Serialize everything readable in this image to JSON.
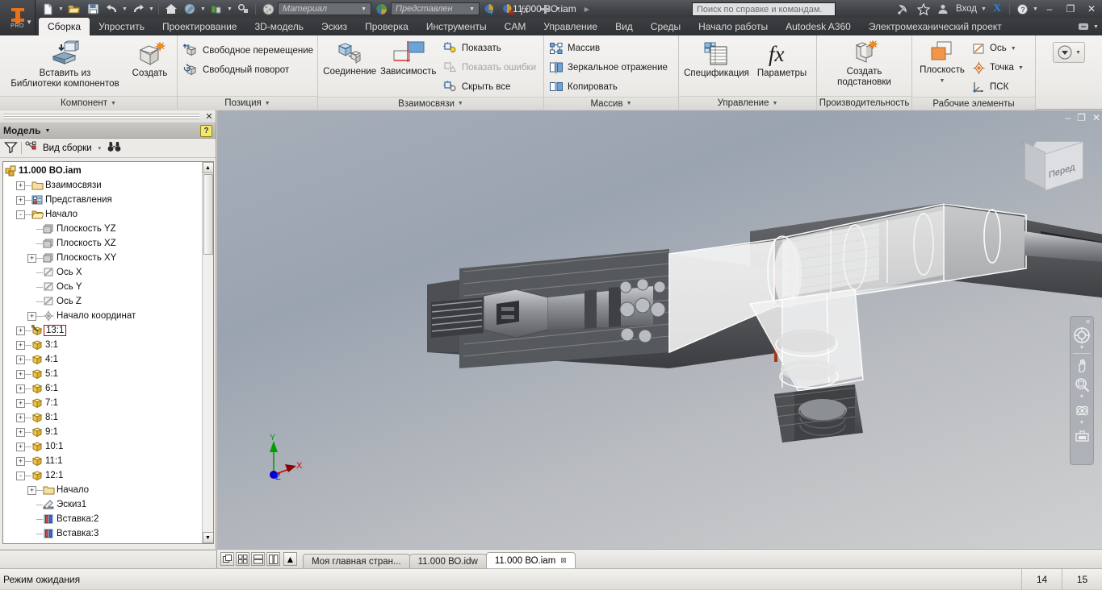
{
  "titlebar": {
    "document_title": "11.000 ВО.iam",
    "material_combo": "Материал",
    "appearance_combo": "Представлен",
    "search_placeholder": "Поиск по справке и командам.",
    "signin_label": "Вход",
    "minimize": "–",
    "restore": "❐",
    "close": "✕",
    "quick_access": [
      {
        "name": "new-file-icon",
        "label": "Создать"
      },
      {
        "name": "open-file-icon",
        "label": "Открыть"
      },
      {
        "name": "save-icon",
        "label": "Сохранить"
      },
      {
        "name": "undo-icon",
        "label": "Отменить"
      },
      {
        "name": "redo-icon",
        "label": "Повторить"
      },
      {
        "name": "home-icon",
        "label": "Домой"
      },
      {
        "name": "appearance-icon",
        "label": "Внешний вид"
      },
      {
        "name": "update-icon",
        "label": "Обновить"
      },
      {
        "name": "select-icon",
        "label": "Выбрать"
      }
    ]
  },
  "tabs": [
    {
      "label": "Сборка",
      "active": true
    },
    {
      "label": "Упростить",
      "active": false
    },
    {
      "label": "Проектирование",
      "active": false
    },
    {
      "label": "3D-модель",
      "active": false
    },
    {
      "label": "Эскиз",
      "active": false
    },
    {
      "label": "Проверка",
      "active": false
    },
    {
      "label": "Инструменты",
      "active": false
    },
    {
      "label": "CAM",
      "active": false
    },
    {
      "label": "Управление",
      "active": false
    },
    {
      "label": "Вид",
      "active": false
    },
    {
      "label": "Среды",
      "active": false
    },
    {
      "label": "Начало работы",
      "active": false
    },
    {
      "label": "Autodesk A360",
      "active": false
    },
    {
      "label": "Электромеханический проект",
      "active": false
    }
  ],
  "ribbon": {
    "panels": [
      {
        "title": "Компонент",
        "has_caret": true,
        "big_buttons": [
          {
            "label_line1": "Вставить из",
            "label_line2": "Библиотеки компонентов",
            "icon": "insert-from-library-icon",
            "dropdown": true
          },
          {
            "label_line1": "Создать",
            "label_line2": "",
            "icon": "create-component-icon",
            "dropdown": false
          }
        ]
      },
      {
        "title": "Позиция",
        "has_caret": true,
        "small_buttons": [
          {
            "label": "Свободное перемещение",
            "icon": "free-move-icon",
            "disabled": false
          },
          {
            "label": "Свободный поворот",
            "icon": "free-rotate-icon",
            "disabled": false
          }
        ]
      },
      {
        "title": "Взаимосвязи",
        "has_caret": true,
        "big_buttons": [
          {
            "label_line1": "Соединение",
            "label_line2": "",
            "icon": "joint-icon",
            "dropdown": false
          },
          {
            "label_line1": "Зависимость",
            "label_line2": "",
            "icon": "constraint-icon",
            "dropdown": false
          }
        ],
        "small_buttons": [
          {
            "label": "Показать",
            "icon": "show-constraints-icon",
            "disabled": false
          },
          {
            "label": "Показать ошибки",
            "icon": "show-errors-icon",
            "disabled": true
          },
          {
            "label": "Скрыть все",
            "icon": "hide-all-icon",
            "disabled": false
          }
        ]
      },
      {
        "title": "Массив",
        "has_caret": true,
        "small_buttons": [
          {
            "label": "Массив",
            "icon": "pattern-icon",
            "disabled": false
          },
          {
            "label": "Зеркальное отражение",
            "icon": "mirror-icon",
            "disabled": false
          },
          {
            "label": "Копировать",
            "icon": "copy-icon",
            "disabled": false
          }
        ]
      },
      {
        "title": "Управление",
        "has_caret": true,
        "big_buttons": [
          {
            "label_line1": "Спецификация",
            "label_line2": "",
            "icon": "bom-icon",
            "dropdown": false
          },
          {
            "label_line1": "Параметры",
            "label_line2": "",
            "icon": "parameters-fx-icon",
            "dropdown": false
          }
        ]
      },
      {
        "title": "Производительность",
        "has_caret": false,
        "big_buttons": [
          {
            "label_line1": "Создать",
            "label_line2": "подстановки",
            "icon": "create-substitute-icon",
            "dropdown": true
          }
        ]
      },
      {
        "title": "Рабочие элементы",
        "has_caret": false,
        "big_buttons": [
          {
            "label_line1": "Плоскость",
            "label_line2": "",
            "icon": "work-plane-icon",
            "dropdown": true
          }
        ],
        "small_buttons": [
          {
            "label": "Ось",
            "icon": "work-axis-icon",
            "disabled": false,
            "dropdown": true
          },
          {
            "label": "Точка",
            "icon": "work-point-icon",
            "disabled": false,
            "dropdown": true
          },
          {
            "label": "ПСК",
            "icon": "ucs-icon",
            "disabled": false,
            "dropdown": false
          }
        ]
      },
      {
        "title": "",
        "has_caret": false,
        "big_buttons": [
          {
            "label_line1": "",
            "label_line2": "",
            "icon": "panel-overflow-icon",
            "dropdown": true
          }
        ]
      }
    ]
  },
  "browser": {
    "panel_title": "Модель",
    "help_badge": "?",
    "toolbar": {
      "filter_icon": "filter-icon",
      "view_rep_label": "Вид сборки",
      "view_rep_caret": "▾",
      "find_icon": "binoculars-icon"
    },
    "tree": [
      {
        "label": "11.000 ВО.iam",
        "depth": 0,
        "expander": "",
        "icon": "assembly-icon",
        "bold": true,
        "selected": false
      },
      {
        "label": "Взаимосвязи",
        "depth": 1,
        "expander": "+",
        "icon": "folder-icon",
        "bold": false,
        "selected": false
      },
      {
        "label": "Представления",
        "depth": 1,
        "expander": "+",
        "icon": "representations-icon",
        "bold": false,
        "selected": false
      },
      {
        "label": "Начало",
        "depth": 1,
        "expander": "-",
        "icon": "open-folder-icon",
        "bold": false,
        "selected": false
      },
      {
        "label": "Плоскость YZ",
        "depth": 2,
        "expander": "",
        "icon": "plane-icon",
        "bold": false,
        "selected": false
      },
      {
        "label": "Плоскость XZ",
        "depth": 2,
        "expander": "",
        "icon": "plane-icon",
        "bold": false,
        "selected": false
      },
      {
        "label": "Плоскость XY",
        "depth": 2,
        "expander": "+",
        "icon": "plane-icon",
        "bold": false,
        "selected": false
      },
      {
        "label": "Ось X",
        "depth": 2,
        "expander": "",
        "icon": "axis-icon",
        "bold": false,
        "selected": false
      },
      {
        "label": "Ось Y",
        "depth": 2,
        "expander": "",
        "icon": "axis-icon",
        "bold": false,
        "selected": false
      },
      {
        "label": "Ось Z",
        "depth": 2,
        "expander": "",
        "icon": "axis-icon",
        "bold": false,
        "selected": false
      },
      {
        "label": "Начало координат",
        "depth": 2,
        "expander": "+",
        "icon": "origin-point-icon",
        "bold": false,
        "selected": false
      },
      {
        "label": "13:1",
        "depth": 1,
        "expander": "+",
        "icon": "grounded-component-icon",
        "bold": false,
        "selected": true
      },
      {
        "label": "3:1",
        "depth": 1,
        "expander": "+",
        "icon": "component-icon",
        "bold": false,
        "selected": false
      },
      {
        "label": "4:1",
        "depth": 1,
        "expander": "+",
        "icon": "component-icon",
        "bold": false,
        "selected": false
      },
      {
        "label": "5:1",
        "depth": 1,
        "expander": "+",
        "icon": "component-icon",
        "bold": false,
        "selected": false
      },
      {
        "label": "6:1",
        "depth": 1,
        "expander": "+",
        "icon": "component-icon",
        "bold": false,
        "selected": false
      },
      {
        "label": "7:1",
        "depth": 1,
        "expander": "+",
        "icon": "component-icon",
        "bold": false,
        "selected": false
      },
      {
        "label": "8:1",
        "depth": 1,
        "expander": "+",
        "icon": "component-icon",
        "bold": false,
        "selected": false
      },
      {
        "label": "9:1",
        "depth": 1,
        "expander": "+",
        "icon": "component-icon",
        "bold": false,
        "selected": false
      },
      {
        "label": "10:1",
        "depth": 1,
        "expander": "+",
        "icon": "component-icon",
        "bold": false,
        "selected": false
      },
      {
        "label": "11:1",
        "depth": 1,
        "expander": "+",
        "icon": "component-icon",
        "bold": false,
        "selected": false
      },
      {
        "label": "12:1",
        "depth": 1,
        "expander": "-",
        "icon": "component-icon",
        "bold": false,
        "selected": false
      },
      {
        "label": "Начало",
        "depth": 2,
        "expander": "+",
        "icon": "folder-icon",
        "bold": false,
        "selected": false
      },
      {
        "label": "Эскиз1",
        "depth": 2,
        "expander": "",
        "icon": "sketch-icon",
        "bold": false,
        "selected": false
      },
      {
        "label": "Вставка:2",
        "depth": 2,
        "expander": "",
        "icon": "insert-constraint-icon",
        "bold": false,
        "selected": false
      },
      {
        "label": "Вставка:3",
        "depth": 2,
        "expander": "",
        "icon": "insert-constraint-icon",
        "bold": false,
        "selected": false
      }
    ]
  },
  "viewport": {
    "window_controls": {
      "minimize": "–",
      "restore": "❐",
      "close": "✕"
    },
    "viewcube_label": "Перед",
    "navbar": [
      {
        "name": "steering-wheel-icon"
      },
      {
        "name": "pan-icon"
      },
      {
        "name": "zoom-icon"
      },
      {
        "name": "orbit-icon"
      },
      {
        "name": "look-at-icon"
      }
    ],
    "axis_triad": {
      "x": "X",
      "y": "Y",
      "z": "Z",
      "x_color": "#cc0000",
      "y_color": "#00a000",
      "z_color": "#0000cc"
    }
  },
  "doctabs": {
    "view_buttons": [
      {
        "name": "cascade-view-button"
      },
      {
        "name": "tile-view-button"
      },
      {
        "name": "horizontal-tile-button"
      },
      {
        "name": "vertical-tile-button"
      },
      {
        "name": "tabs-scroll-up-button"
      }
    ],
    "tabs": [
      {
        "label": "Моя главная стран...",
        "active": false,
        "closable": false
      },
      {
        "label": "11.000 ВО.idw",
        "active": false,
        "closable": false
      },
      {
        "label": "11.000 ВО.iam",
        "active": true,
        "closable": true
      }
    ]
  },
  "statusbar": {
    "message": "Режим ожидания",
    "cell1": "14",
    "cell2": "15"
  },
  "colors": {
    "accent_orange": "#e8721c",
    "selection_red": "#c00000",
    "ribbon_bg": "#efedea",
    "titlebar_dark": "#3c3f42",
    "viewport_bg": "#a7aeb8"
  }
}
